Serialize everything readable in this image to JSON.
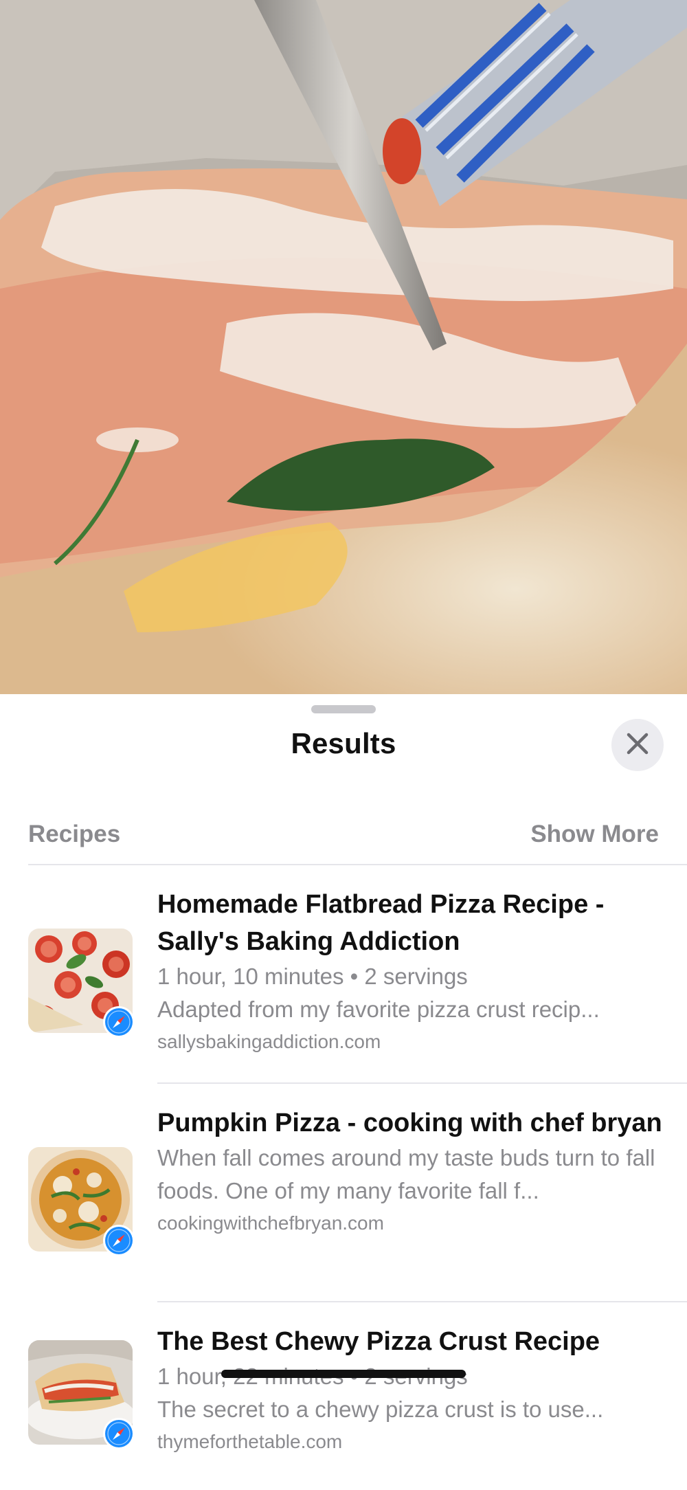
{
  "sheet": {
    "title": "Results",
    "close_icon": "xmark-icon"
  },
  "section": {
    "label": "Recipes",
    "show_more": "Show More"
  },
  "results": [
    {
      "title": "Homemade Flatbread Pizza Recipe - Sally's Baking Addiction",
      "meta": "1 hour, 10 minutes • 2 servings",
      "description": "Adapted from my favorite pizza crust recip...",
      "site": "sallysbakingaddiction.com",
      "badge_icon": "safari-icon"
    },
    {
      "title": "Pumpkin Pizza - cooking with chef bryan",
      "meta": "",
      "description": "When fall comes around my taste buds turn to fall foods. One of my many favorite fall f...",
      "site": "cookingwithchefbryan.com",
      "badge_icon": "safari-icon"
    },
    {
      "title": "The Best Chewy Pizza Crust Recipe",
      "meta": "1 hour, 22 minutes • 2 servings",
      "description": "The secret to a chewy pizza crust is to use...",
      "site": "thymeforthetable.com",
      "badge_icon": "safari-icon"
    }
  ],
  "colors": {
    "secondary_text": "#8a8a8e",
    "divider": "#e5e5ea",
    "close_button_bg": "#ececf0",
    "safari_blue": "#1a8cff"
  }
}
